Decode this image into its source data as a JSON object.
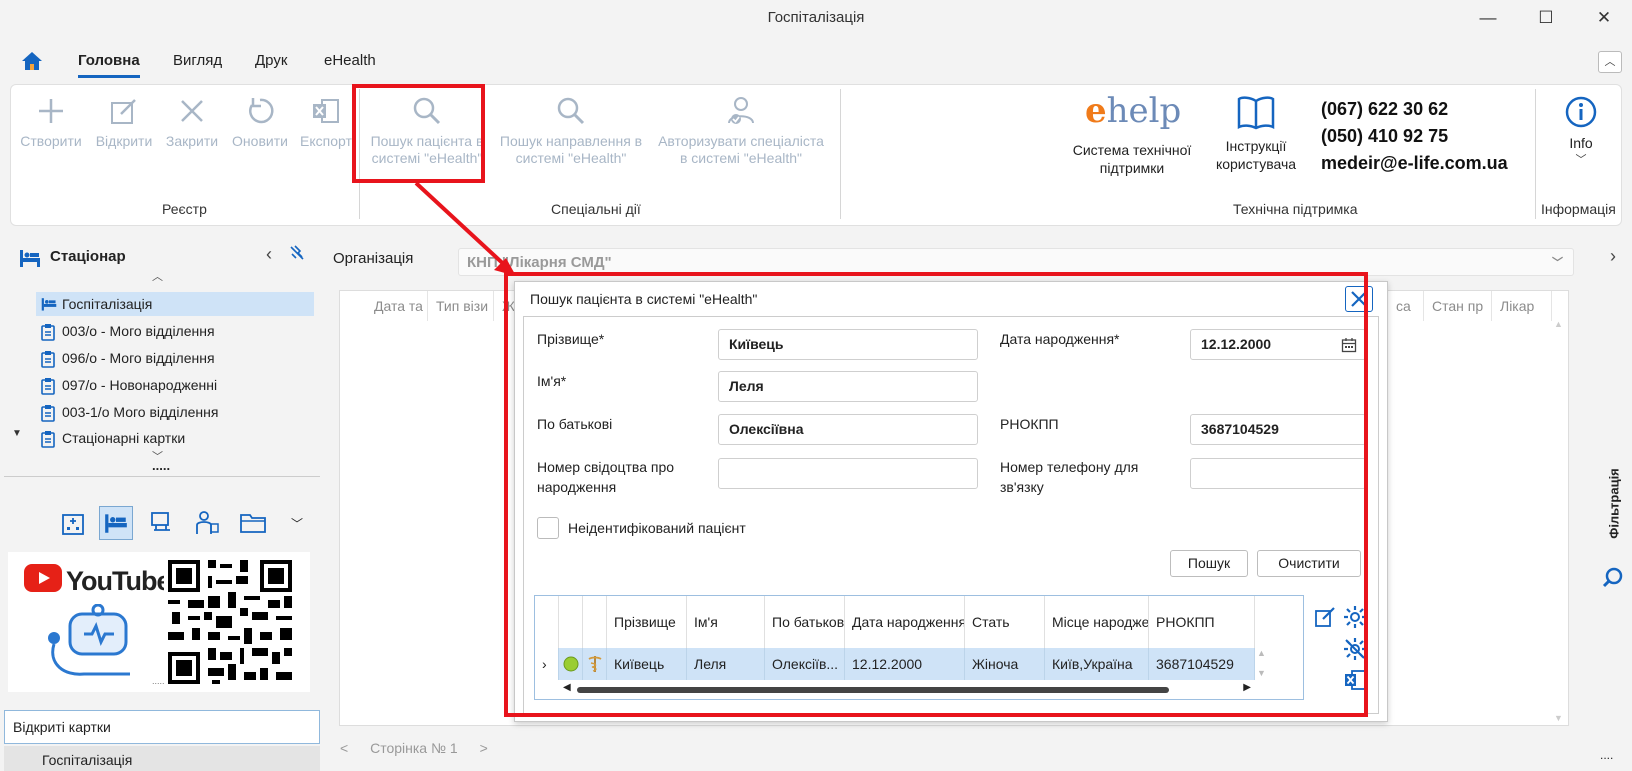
{
  "window": {
    "title": "Госпіталізація"
  },
  "ribbon_tabs": [
    {
      "label": "Головна"
    },
    {
      "label": "Вигляд"
    },
    {
      "label": "Друк"
    },
    {
      "label": "eHealth"
    }
  ],
  "ribbon": {
    "registry": {
      "label": "Реєстр",
      "create": "Створити",
      "open": "Відкрити",
      "close": "Закрити",
      "refresh": "Оновити",
      "export": "Експорт"
    },
    "special": {
      "label": "Спеціальні дії",
      "search_patient_l1": "Пошук пацієнта в",
      "search_patient_l2": "системі \"eHealth\"",
      "search_referral_l1": "Пошук направлення в",
      "search_referral_l2": "системі \"eHealth\"",
      "authorize_l1": "Авторизувати спеціаліста",
      "authorize_l2": "в системі \"eHealth\""
    },
    "support": {
      "label": "Технічна підтримка",
      "ehelp_e": "e",
      "ehelp_text": "help",
      "system_l1": "Система технічної",
      "system_l2": "підтримки",
      "manual_l1": "Інструкції",
      "manual_l2": "користувача",
      "phone1": "(067) 622 30 62",
      "phone2": "(050) 410 92 75",
      "email": "medeir@e-life.com.ua"
    },
    "info": {
      "label": "Інформація",
      "button": "Info"
    }
  },
  "sidebar": {
    "title": "Стаціонар",
    "items": [
      {
        "label": "Госпіталізація"
      },
      {
        "label": "003/о - Мого відділення"
      },
      {
        "label": "096/о - Мого відділення"
      },
      {
        "label": "097/о - Новонародженні"
      },
      {
        "label": "003-1/о Мого відділення"
      },
      {
        "label": "Стаціонарні картки"
      }
    ],
    "more": ".....",
    "youtube_label": "YouTube",
    "open_cards_title": "Відкриті картки",
    "open_card_item": "Госпіталізація"
  },
  "main": {
    "org_label": "Організація",
    "org_value": "КНП \"Лікарня СМД\"",
    "bg_columns": [
      "Дата та",
      "Тип візи",
      "Ж",
      "са",
      "Стан пр",
      "Лікар"
    ],
    "pager": {
      "prev": "<",
      "page": "Сторінка № 1",
      "next": ">"
    },
    "filter_tab": "Фільтрація"
  },
  "dialog": {
    "title": "Пошук пацієнта в системі \"eHealth\"",
    "fields": {
      "surname_label": "Прізвище*",
      "surname_value": "Київець",
      "name_label": "Ім'я*",
      "name_value": "Леля",
      "patronymic_label": "По батькові",
      "patronymic_value": "Олексіївна",
      "birthcert_label_l1": "Номер свідоцтва про",
      "birthcert_label_l2": "народження",
      "birthcert_value": "",
      "dob_label": "Дата народження*",
      "dob_value": "12.12.2000",
      "rnokpp_label": "РНОКПП",
      "rnokpp_value": "3687104529",
      "phone_label_l1": "Номер телефону для",
      "phone_label_l2": "зв'язку",
      "phone_value": ""
    },
    "unidentified_label": "Неідентифікований пацієнт",
    "search_btn": "Пошук",
    "clear_btn": "Очистити",
    "results": {
      "columns": [
        "Прізвище",
        "Ім'я",
        "По батькові",
        "Дата народження",
        "Стать",
        "Місце народження",
        "РНОКПП"
      ],
      "rows": [
        {
          "surname": "Київець",
          "name": "Леля",
          "patronymic": "Олексіїв...",
          "dob": "12.12.2000",
          "sex": "Жіноча",
          "birthplace": "Київ,Україна",
          "rnokpp": "3687104529"
        }
      ]
    }
  },
  "colors": {
    "accent": "#1565c0",
    "annotation_red": "#e8141c",
    "disabled_icon": "#a8b6c6",
    "selection": "#cfe3f7"
  }
}
